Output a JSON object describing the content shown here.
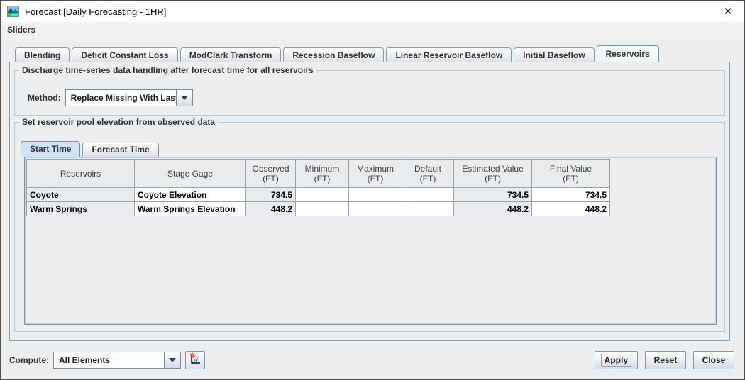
{
  "window": {
    "title": "Forecast [Daily Forecasting - 1HR]",
    "close_glyph": "✕"
  },
  "menu": {
    "sliders_label": "Sliders"
  },
  "tabs": [
    {
      "label": "Blending",
      "selected": false
    },
    {
      "label": "Deficit Constant Loss",
      "selected": false
    },
    {
      "label": "ModClark Transform",
      "selected": false
    },
    {
      "label": "Recession Baseflow",
      "selected": false
    },
    {
      "label": "Linear Reservoir Baseflow",
      "selected": false
    },
    {
      "label": "Initial Baseflow",
      "selected": false
    },
    {
      "label": "Reservoirs",
      "selected": true
    }
  ],
  "discharge_group": {
    "title": "Discharge time-series data handling after forecast time for all reservoirs",
    "method_label": "Method:",
    "method_value": "Replace Missing With Last"
  },
  "pool_group": {
    "title": "Set reservoir pool elevation from observed data",
    "tabs": [
      {
        "label": "Start Time",
        "selected": true
      },
      {
        "label": "Forecast Time",
        "selected": false
      }
    ]
  },
  "table": {
    "columns": [
      {
        "label": "Reservoirs",
        "unit": ""
      },
      {
        "label": "Stage Gage",
        "unit": ""
      },
      {
        "label": "Observed",
        "unit": "(FT)"
      },
      {
        "label": "Minimum",
        "unit": "(FT)"
      },
      {
        "label": "Maximum",
        "unit": "(FT)"
      },
      {
        "label": "Default",
        "unit": "(FT)"
      },
      {
        "label": "Estimated Value",
        "unit": "(FT)"
      },
      {
        "label": "Final Value",
        "unit": "(FT)"
      }
    ],
    "rows": [
      {
        "reservoir": "Coyote",
        "stage_gage": "Coyote Elevation",
        "observed": "734.5",
        "minimum": "",
        "maximum": "",
        "default": "",
        "estimated": "734.5",
        "final": "734.5"
      },
      {
        "reservoir": "Warm Springs",
        "stage_gage": "Warm Springs Elevation",
        "observed": "448.2",
        "minimum": "",
        "maximum": "",
        "default": "",
        "estimated": "448.2",
        "final": "448.2"
      }
    ]
  },
  "footer": {
    "compute_label": "Compute:",
    "compute_value": "All Elements",
    "apply_label": "Apply",
    "reset_label": "Reset",
    "close_label": "Close"
  },
  "colors": {
    "selected_inner_tab_bg": "#cfe3f7",
    "group_border": "#b5cbdf",
    "table_header_bg": "#e9ebec",
    "readonly_cell_bg": "#e9ebec",
    "button_border": "#8195aa",
    "titlebar_bg": "#ffffff",
    "panel_bg": "#eceef0"
  }
}
